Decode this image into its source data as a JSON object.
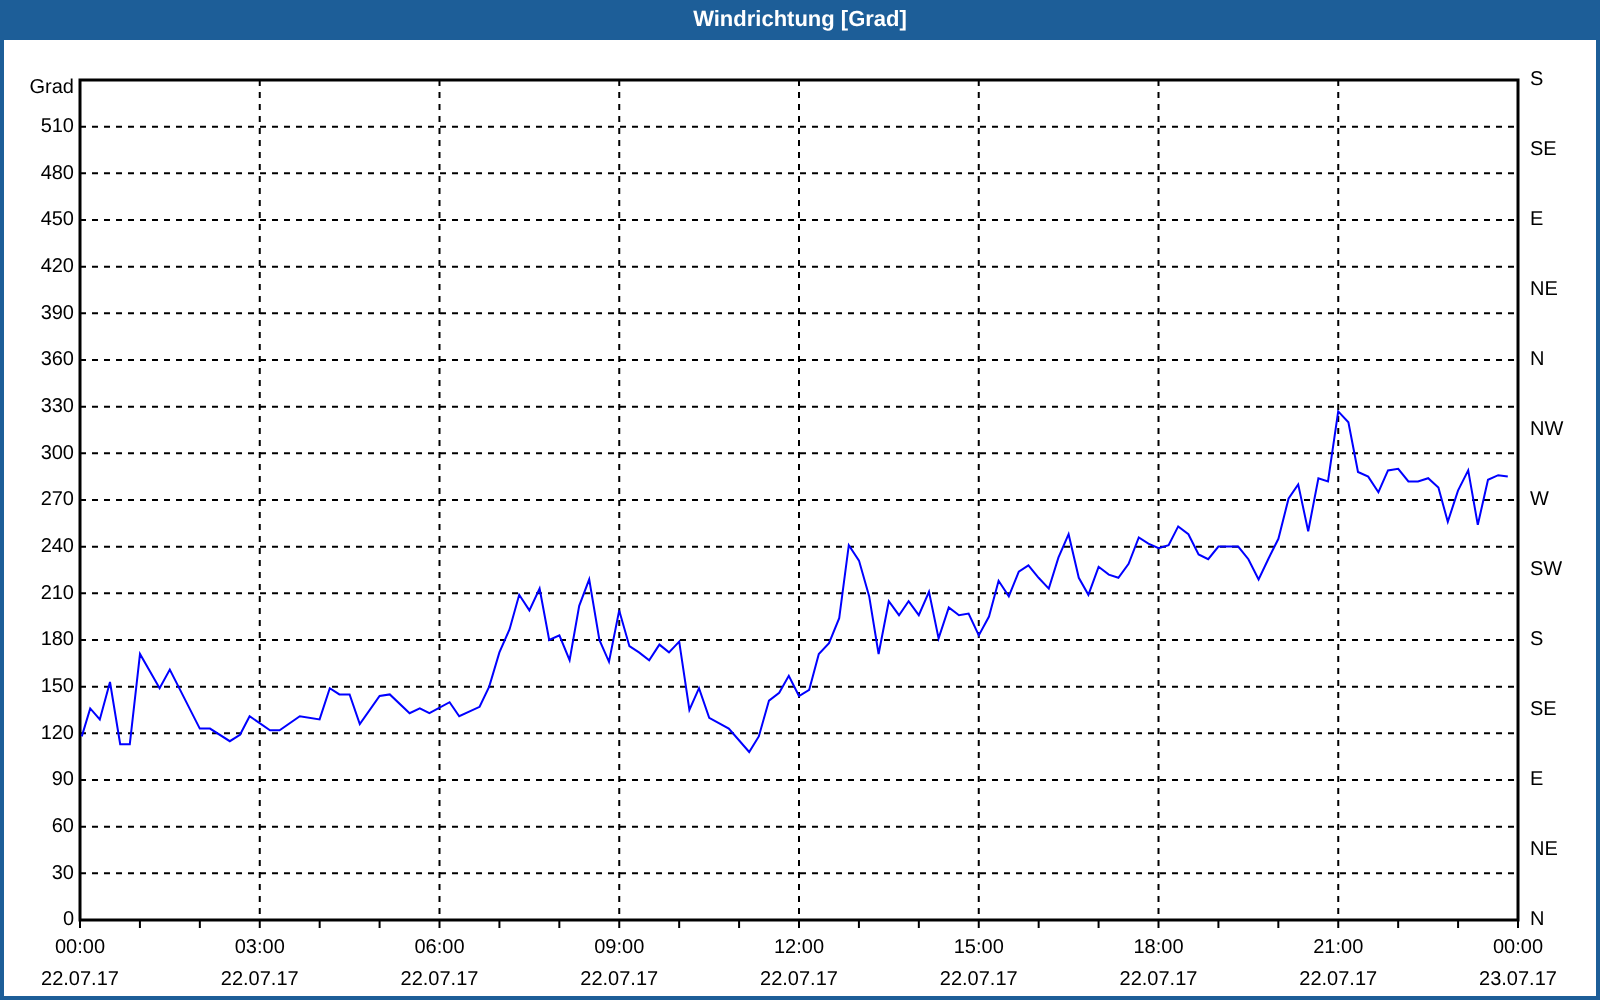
{
  "window": {
    "title": "Windrichtung [Grad]"
  },
  "chart": {
    "chart_data": {
      "type": "line",
      "ylabel": "Grad",
      "xlim": [
        0,
        24
      ],
      "ylim": [
        0,
        540
      ],
      "x": [
        0.03,
        0.17,
        0.33,
        0.5,
        0.67,
        0.83,
        1,
        1.33,
        1.5,
        2,
        2.17,
        2.5,
        2.67,
        2.83,
        3.17,
        3.33,
        3.67,
        4,
        4.17,
        4.33,
        4.5,
        4.67,
        5,
        5.17,
        5.5,
        5.67,
        5.83,
        6.17,
        6.33,
        6.67,
        6.83,
        7,
        7.17,
        7.33,
        7.5,
        7.67,
        7.83,
        8,
        8.17,
        8.33,
        8.5,
        8.67,
        8.83,
        9,
        9.17,
        9.33,
        9.5,
        9.67,
        9.83,
        10,
        10.17,
        10.33,
        10.5,
        10.83,
        11.17,
        11.33,
        11.5,
        11.67,
        11.83,
        12,
        12.17,
        12.33,
        12.5,
        12.67,
        12.83,
        13,
        13.17,
        13.33,
        13.5,
        13.67,
        13.83,
        14,
        14.17,
        14.33,
        14.5,
        14.67,
        14.83,
        15,
        15.17,
        15.33,
        15.5,
        15.67,
        15.83,
        16,
        16.17,
        16.33,
        16.5,
        16.67,
        16.83,
        17,
        17.17,
        17.33,
        17.5,
        17.67,
        17.83,
        18,
        18.17,
        18.33,
        18.5,
        18.67,
        18.83,
        19,
        19.33,
        19.5,
        19.67,
        19.83,
        20,
        20.17,
        20.33,
        20.5,
        20.67,
        20.83,
        21,
        21.17,
        21.33,
        21.5,
        21.67,
        21.83,
        22,
        22.17,
        22.33,
        22.5,
        22.67,
        22.83,
        23,
        23.17,
        23.33,
        23.5,
        23.67,
        23.83
      ],
      "grid": true,
      "series": [
        {
          "color": "#0000ff",
          "values": [
            118,
            136,
            129,
            153,
            113,
            113,
            171,
            149,
            161,
            123,
            123,
            115,
            119,
            131,
            122,
            122,
            131,
            129,
            149,
            145,
            145,
            126,
            144,
            145,
            133,
            136,
            133,
            140,
            131,
            137,
            150,
            172,
            187,
            209,
            199,
            213,
            180,
            183,
            167,
            202,
            219,
            180,
            166,
            199,
            176,
            172,
            167,
            177,
            172,
            179,
            135,
            149,
            130,
            123,
            108,
            118,
            141,
            146,
            157,
            144,
            148,
            171,
            178,
            194,
            241,
            231,
            208,
            171,
            205,
            196,
            205,
            196,
            211,
            181,
            201,
            196,
            197,
            183,
            195,
            218,
            208,
            224,
            228,
            220,
            213,
            233,
            248,
            220,
            209,
            227,
            222,
            220,
            229,
            246,
            242,
            239,
            241,
            253,
            248,
            235,
            232,
            240,
            240,
            232,
            219,
            232,
            245,
            271,
            280,
            250,
            284,
            282,
            327,
            320,
            288,
            285,
            275,
            289,
            290,
            282,
            282,
            284,
            278,
            256,
            276,
            289,
            254,
            283,
            286,
            285
          ]
        }
      ],
      "xticks": [
        {
          "value": 0,
          "label": "00:00"
        },
        {
          "value": 3,
          "label": "03:00"
        },
        {
          "value": 6,
          "label": "06:00"
        },
        {
          "value": 9,
          "label": "09:00"
        },
        {
          "value": 12,
          "label": "12:00"
        },
        {
          "value": 15,
          "label": "15:00"
        },
        {
          "value": 18,
          "label": "18:00"
        },
        {
          "value": 21,
          "label": "21:00"
        },
        {
          "value": 24,
          "label": "00:00"
        }
      ],
      "yticks": [
        0,
        30,
        60,
        90,
        120,
        150,
        180,
        210,
        240,
        270,
        300,
        330,
        360,
        390,
        420,
        450,
        480,
        510
      ]
    },
    "x_tick_dates": [
      "22.07.17",
      "22.07.17",
      "22.07.17",
      "22.07.17",
      "22.07.17",
      "22.07.17",
      "22.07.17",
      "22.07.17",
      "23.07.17"
    ],
    "right_axis_labels": [
      "S",
      "SE",
      "E",
      "NE",
      "N",
      "NW",
      "W",
      "SW",
      "S",
      "SE",
      "E",
      "NE",
      "N"
    ]
  }
}
